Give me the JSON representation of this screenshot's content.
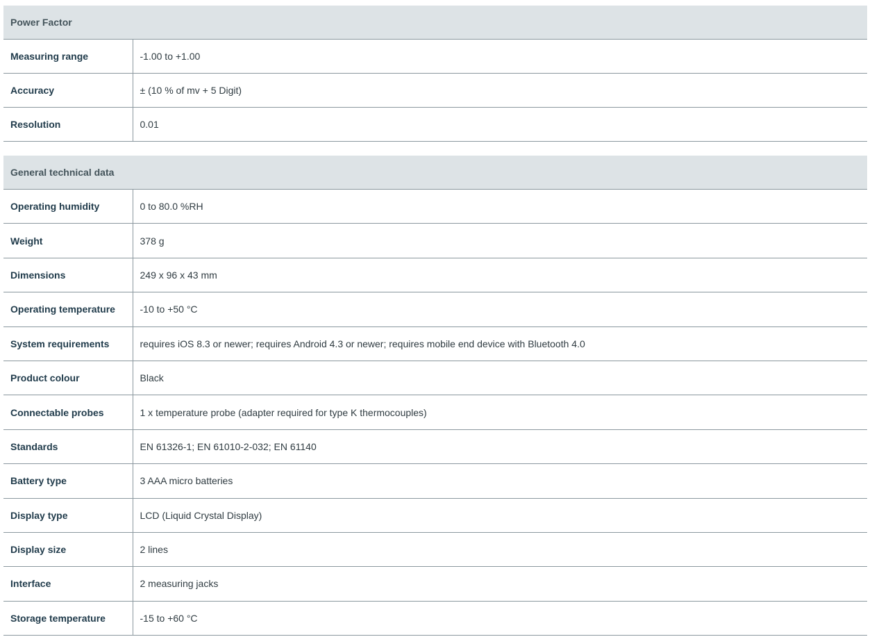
{
  "power_factor": {
    "title": "Power Factor",
    "rows": [
      {
        "label": "Measuring range",
        "value": "-1.00 to +1.00"
      },
      {
        "label": "Accuracy",
        "value": "± (10 % of mv + 5 Digit)"
      },
      {
        "label": "Resolution",
        "value": "0.01"
      }
    ]
  },
  "general": {
    "title": "General technical data",
    "rows": [
      {
        "label": "Operating humidity",
        "value": "0 to 80.0 %RH"
      },
      {
        "label": "Weight",
        "value": "378 g"
      },
      {
        "label": "Dimensions",
        "value": "249 x 96 x 43 mm"
      },
      {
        "label": "Operating temperature",
        "value": "-10 to +50 °C"
      },
      {
        "label": "System requirements",
        "value": "requires iOS 8.3 or newer; requires Android 4.3 or newer; requires mobile end device with Bluetooth 4.0"
      },
      {
        "label": "Product colour",
        "value": "Black"
      },
      {
        "label": "Connectable probes",
        "value": "1 x temperature probe (adapter required for type K thermocouples)"
      },
      {
        "label": "Standards",
        "value": "EN 61326-1; EN 61010-2-032; EN 61140"
      },
      {
        "label": "Battery type",
        "value": "3 AAA micro batteries"
      },
      {
        "label": "Display type",
        "value": "LCD (Liquid Crystal Display)"
      },
      {
        "label": "Display size",
        "value": "2 lines"
      },
      {
        "label": "Interface",
        "value": "2 measuring jacks"
      },
      {
        "label": "Storage temperature",
        "value": "-15 to +60 °C"
      }
    ]
  }
}
